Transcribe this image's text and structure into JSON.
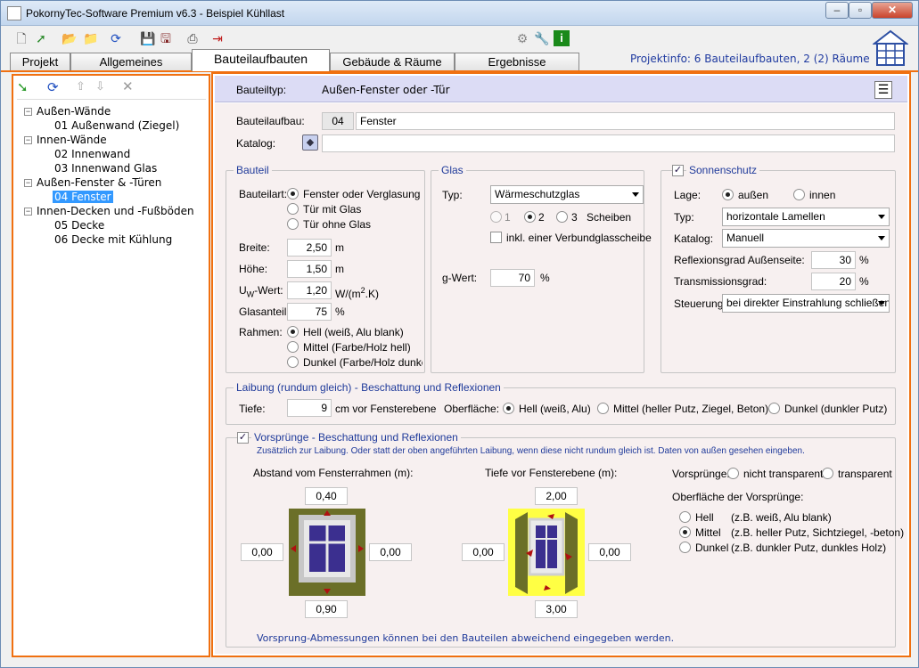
{
  "window": {
    "title": "PokornyTec-Software Premium v6.3  -  Beispiel Kühllast"
  },
  "toolbar": {
    "icons": [
      "new-icon",
      "open-import-icon",
      "folder-icon",
      "folder-export-icon",
      "refresh-icon",
      "save-icon",
      "save-as-icon",
      "print-icon",
      "exit-icon",
      "gear-icon",
      "wrench-icon",
      "info-icon"
    ]
  },
  "tabs": [
    "Projekt",
    "Allgemeines",
    "Bauteilaufbauten",
    "Gebäude & Räume",
    "Ergebnisse"
  ],
  "projinfo": "Projektinfo: 6 Bauteilaufbauten,  2 (2) Räume",
  "tree": [
    {
      "label": "Außen-Wände",
      "level": 0
    },
    {
      "label": "01 Außenwand (Ziegel)",
      "level": 1
    },
    {
      "label": "Innen-Wände",
      "level": 0
    },
    {
      "label": "02 Innenwand",
      "level": 1
    },
    {
      "label": "03 Innenwand Glas",
      "level": 1
    },
    {
      "label": "Außen-Fenster & -Türen",
      "level": 0
    },
    {
      "label": "04 Fenster",
      "level": 1,
      "selected": true
    },
    {
      "label": "Innen-Decken und -Fußböden",
      "level": 0
    },
    {
      "label": "05 Decke",
      "level": 1
    },
    {
      "label": "06 Decke mit Kühlung",
      "level": 1
    }
  ],
  "header": {
    "label": "Bauteiltyp:",
    "value": "Außen-Fenster oder -Tür"
  },
  "bauteilaufbau": {
    "label": "Bauteilaufbau:",
    "nr": "04",
    "name": "Fenster"
  },
  "katalog": {
    "label": "Katalog:",
    "value": ""
  },
  "bauteil": {
    "title": "Bauteil",
    "art_label": "Bauteilart:",
    "arten": [
      "Fenster oder Verglasung",
      "Tür mit Glas",
      "Tür ohne Glas"
    ],
    "breite_label": "Breite:",
    "breite": "2,50",
    "breite_unit": "m",
    "hoehe_label": "Höhe:",
    "hoehe": "1,50",
    "hoehe_unit": "m",
    "uw_label_u": "U",
    "uw_label_sub": "W",
    "uw_label_rest": "-Wert:",
    "uw": "1,20",
    "uw_unit_a": "W/(m",
    "uw_unit_sup": "2",
    "uw_unit_b": ".K)",
    "glas_label": "Glasanteil:",
    "glas": "75",
    "glas_unit": "%",
    "rahmen_label": "Rahmen:",
    "rahmen": [
      "Hell (weiß, Alu blank)",
      "Mittel (Farbe/Holz hell)",
      "Dunkel (Farbe/Holz dunkel"
    ]
  },
  "glas": {
    "title": "Glas",
    "typ_label": "Typ:",
    "typ": "Wärmeschutzglas",
    "scheiben": [
      "1",
      "2",
      "3"
    ],
    "scheiben_label": "Scheiben",
    "verbund": "inkl. einer Verbundglasscheibe",
    "g_label": "g-Wert:",
    "g": "70",
    "g_unit": "%"
  },
  "sonnenschutz": {
    "title": "Sonnenschutz",
    "lage_label": "Lage:",
    "lage": [
      "außen",
      "innen"
    ],
    "typ_label": "Typ:",
    "typ": "horizontale Lamellen",
    "katalog_label": "Katalog:",
    "katalog": "Manuell",
    "refl_label": "Reflexionsgrad Außenseite:",
    "refl": "30",
    "refl_unit": "%",
    "trans_label": "Transmissionsgrad:",
    "trans": "20",
    "trans_unit": "%",
    "steuer_label": "Steuerung:",
    "steuer": "bei direkter Einstrahlung schließen"
  },
  "laibung": {
    "title": "Laibung (rundum gleich) - Beschattung und Reflexionen",
    "tiefe_label": "Tiefe:",
    "tiefe": "9",
    "tiefe_unit": "cm vor Fensterebene",
    "oberflaeche_label": "Oberfläche:",
    "options": [
      "Hell (weiß, Alu)",
      "Mittel (heller Putz, Ziegel, Beton)",
      "Dunkel (dunkler Putz)"
    ]
  },
  "vorspruenge": {
    "title": "Vorsprünge - Beschattung und Reflexionen",
    "hint": "Zusätzlich zur Laibung. Oder statt der oben angeführten Laibung, wenn diese nicht rundum gleich ist. Daten von außen gesehen eingeben.",
    "abstand_label": "Abstand vom Fensterrahmen (m):",
    "abstand": {
      "top": "0,40",
      "left": "0,00",
      "right": "0,00",
      "bottom": "0,90"
    },
    "tiefe_label": "Tiefe vor Fensterebene (m):",
    "tiefe": {
      "top": "2,00",
      "left": "0,00",
      "right": "0,00",
      "bottom": "3,00"
    },
    "vorspr_label": "Vorsprünge:",
    "transp": [
      "nicht transparent",
      "transparent"
    ],
    "oberfl_label": "Oberfläche der Vorsprünge:",
    "oberfl": [
      {
        "name": "Hell",
        "desc": "(z.B. weiß, Alu blank)"
      },
      {
        "name": "Mittel",
        "desc": "(z.B. heller Putz, Sichtziegel, -beton)"
      },
      {
        "name": "Dunkel",
        "desc": "(z.B. dunkler Putz, dunkles Holz)"
      }
    ],
    "footer": "Vorsprung-Abmessungen können bei den Bauteilen abweichend eingegeben werden."
  }
}
